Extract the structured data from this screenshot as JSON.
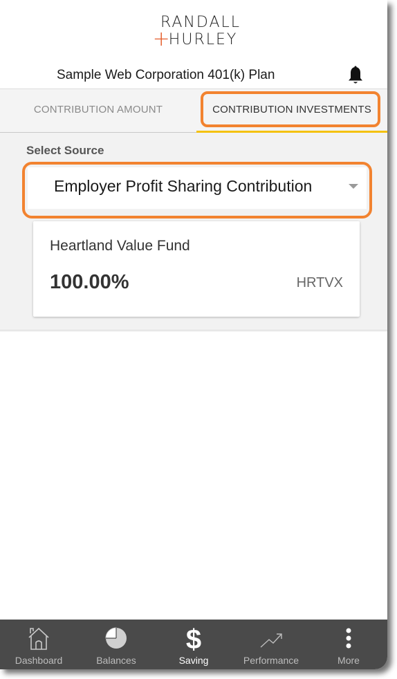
{
  "brand": {
    "line1": "RANDALL",
    "line2": "HURLEY",
    "accent_color": "#e55d2b"
  },
  "header": {
    "plan_name": "Sample Web Corporation 401(k) Plan",
    "notification_icon": "bell-icon"
  },
  "tabs": [
    {
      "label": "CONTRIBUTION AMOUNT",
      "active": false
    },
    {
      "label": "CONTRIBUTION INVESTMENTS",
      "active": true
    }
  ],
  "source": {
    "label": "Select Source",
    "selected": "Employer Profit Sharing Contribution"
  },
  "fund": {
    "name": "Heartland Value Fund",
    "percent": "100.00%",
    "ticker": "HRTVX"
  },
  "nav": [
    {
      "label": "Dashboard",
      "icon": "home-icon",
      "active": false
    },
    {
      "label": "Balances",
      "icon": "pie-chart-icon",
      "active": false
    },
    {
      "label": "Saving",
      "icon": "dollar-icon",
      "active": true
    },
    {
      "label": "Performance",
      "icon": "trend-line-icon",
      "active": false
    },
    {
      "label": "More",
      "icon": "more-vertical-icon",
      "active": false
    }
  ],
  "colors": {
    "highlight": "#f28330",
    "tab_indicator": "#f4c20d",
    "nav_background": "#4a4a4a"
  }
}
